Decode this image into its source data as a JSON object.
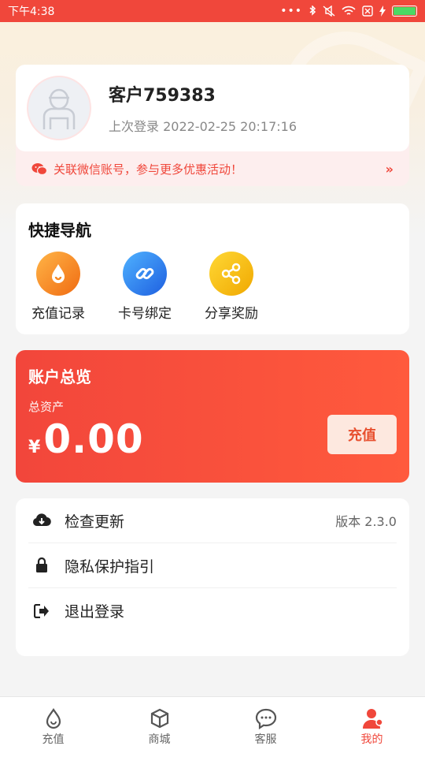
{
  "status_bar": {
    "time": "下午4:38"
  },
  "profile": {
    "name": "客户759383",
    "last_login": "上次登录 2022-02-25 20:17:16"
  },
  "wechat_banner": {
    "text": "关联微信账号，参与更多优惠活动！",
    "arrow": "»"
  },
  "quick_nav": {
    "title": "快捷导航",
    "items": [
      {
        "label": "充值记录",
        "icon": "drop-icon",
        "color": "#f7871f"
      },
      {
        "label": "卡号绑定",
        "icon": "link-icon",
        "color": "#2d7ff0"
      },
      {
        "label": "分享奖励",
        "icon": "share-icon",
        "color": "#f6b800"
      }
    ]
  },
  "account": {
    "title": "账户总览",
    "asset_label": "总资产",
    "currency": "¥",
    "amount": "0.00",
    "recharge_label": "充值"
  },
  "settings": [
    {
      "label": "检查更新",
      "value": "版本 2.3.0",
      "icon": "cloud-download-icon"
    },
    {
      "label": "隐私保护指引",
      "value": "",
      "icon": "lock-icon"
    },
    {
      "label": "退出登录",
      "value": "",
      "icon": "logout-icon"
    }
  ],
  "tabs": [
    {
      "label": "充值",
      "icon": "drop-icon",
      "active": false
    },
    {
      "label": "商城",
      "icon": "box-icon",
      "active": false
    },
    {
      "label": "客服",
      "icon": "chat-icon",
      "active": false
    },
    {
      "label": "我的",
      "icon": "user-icon",
      "active": true
    }
  ],
  "colors": {
    "accent": "#f0473b",
    "orange": "#f7871f",
    "blue": "#2d7ff0",
    "yellow": "#f6b800"
  }
}
